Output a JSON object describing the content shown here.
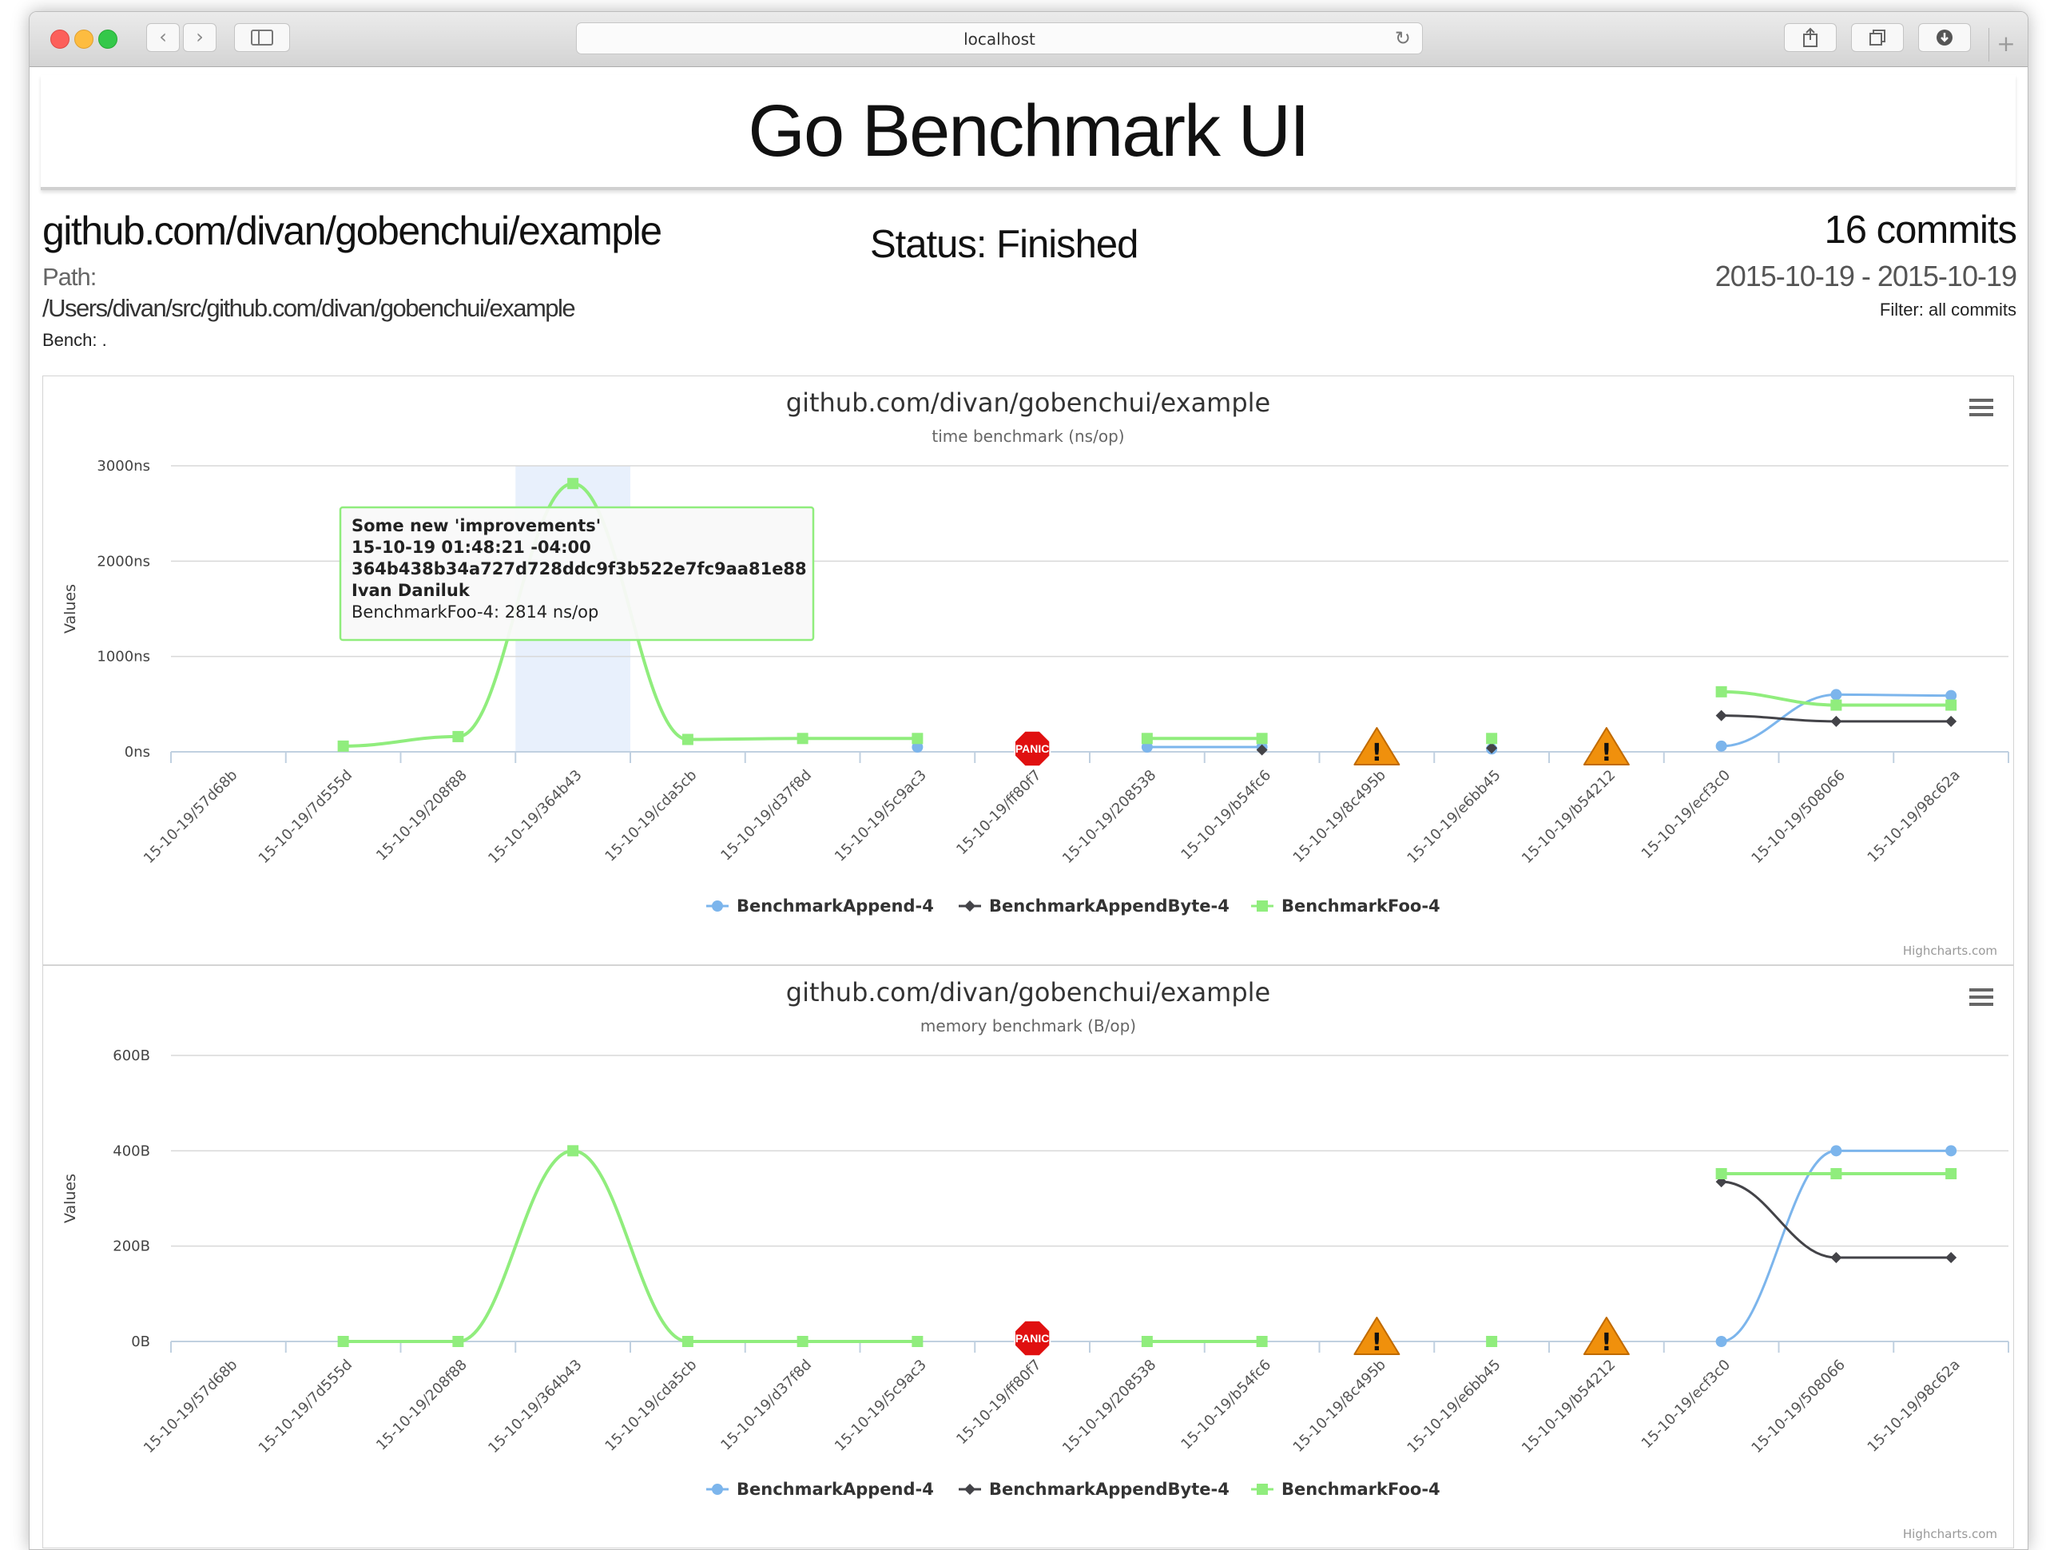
{
  "browser": {
    "url": "localhost",
    "colors": {
      "close": "#fc605b",
      "minimize": "#fdbc40",
      "zoom": "#34c84a"
    }
  },
  "page": {
    "title": "Go Benchmark UI",
    "package": "github.com/divan/gobenchui/example",
    "path_label": "Path:",
    "path": "/Users/divan/src/github.com/divan/gobenchui/example",
    "bench": "Bench: .",
    "status": "Status: Finished",
    "commits": "16 commits",
    "date_range": "2015-10-19 - 2015-10-19",
    "filter": "Filter: all commits"
  },
  "chart_data": [
    {
      "type": "line",
      "title": "github.com/divan/gobenchui/example",
      "subtitle": "time benchmark (ns/op)",
      "ylabel": "Values",
      "ylim": [
        0,
        3000
      ],
      "yticks": [
        "0ns",
        "1000ns",
        "2000ns",
        "3000ns"
      ],
      "ytick_values": [
        0,
        1000,
        2000,
        3000
      ],
      "grid": true,
      "legend": "bottom-center",
      "credits": "Highcharts.com",
      "categories": [
        "15-10-19/57d68b",
        "15-10-19/7d555d",
        "15-10-19/208f88",
        "15-10-19/364b43",
        "15-10-19/cda5cb",
        "15-10-19/d37f8d",
        "15-10-19/5c9ac3",
        "15-10-19/ff80f7",
        "15-10-19/208538",
        "15-10-19/b54fc6",
        "15-10-19/8c495b",
        "15-10-19/e6bb45",
        "15-10-19/b54212",
        "15-10-19/ecf3c0",
        "15-10-19/508066",
        "15-10-19/98c62a"
      ],
      "series": [
        {
          "name": "BenchmarkAppend-4",
          "color": "#7cb5ec",
          "marker": "circle",
          "values": [
            null,
            null,
            null,
            null,
            null,
            null,
            50,
            null,
            50,
            50,
            null,
            30,
            null,
            60,
            600,
            590
          ]
        },
        {
          "name": "BenchmarkAppendByte-4",
          "color": "#434348",
          "marker": "diamond",
          "values": [
            null,
            null,
            null,
            null,
            null,
            null,
            null,
            null,
            null,
            20,
            null,
            40,
            null,
            380,
            320,
            320
          ]
        },
        {
          "name": "BenchmarkFoo-4",
          "color": "#90ed7d",
          "marker": "square",
          "values": [
            null,
            60,
            160,
            2814,
            130,
            140,
            140,
            null,
            140,
            140,
            null,
            140,
            null,
            630,
            490,
            490
          ]
        }
      ],
      "error_markers": [
        {
          "category": "15-10-19/ff80f7",
          "kind": "panic",
          "label": "PANIC"
        },
        {
          "category": "15-10-19/8c495b",
          "kind": "warning",
          "label": "!"
        },
        {
          "category": "15-10-19/b54212",
          "kind": "warning",
          "label": "!"
        }
      ],
      "highlight_category": "15-10-19/364b43",
      "tooltip": {
        "lines": [
          "Some new 'improvements'",
          "15-10-19 01:48:21 -04:00",
          "364b438b34a727d728ddc9f3b522e7fc9aa81e88",
          "Ivan Daniluk",
          "BenchmarkFoo-4: 2814 ns/op"
        ],
        "border_color": "#90ed7d"
      }
    },
    {
      "type": "line",
      "title": "github.com/divan/gobenchui/example",
      "subtitle": "memory benchmark (B/op)",
      "ylabel": "Values",
      "ylim": [
        0,
        600
      ],
      "yticks": [
        "0B",
        "200B",
        "400B",
        "600B"
      ],
      "ytick_values": [
        0,
        200,
        400,
        600
      ],
      "grid": true,
      "legend": "bottom-center",
      "credits": "Highcharts.com",
      "categories": [
        "15-10-19/57d68b",
        "15-10-19/7d555d",
        "15-10-19/208f88",
        "15-10-19/364b43",
        "15-10-19/cda5cb",
        "15-10-19/d37f8d",
        "15-10-19/5c9ac3",
        "15-10-19/ff80f7",
        "15-10-19/208538",
        "15-10-19/b54fc6",
        "15-10-19/8c495b",
        "15-10-19/e6bb45",
        "15-10-19/b54212",
        "15-10-19/ecf3c0",
        "15-10-19/508066",
        "15-10-19/98c62a"
      ],
      "series": [
        {
          "name": "BenchmarkAppend-4",
          "color": "#7cb5ec",
          "marker": "circle",
          "values": [
            null,
            null,
            null,
            null,
            null,
            null,
            null,
            null,
            null,
            null,
            null,
            null,
            null,
            0,
            400,
            400
          ]
        },
        {
          "name": "BenchmarkAppendByte-4",
          "color": "#434348",
          "marker": "diamond",
          "values": [
            null,
            null,
            null,
            null,
            null,
            null,
            null,
            null,
            null,
            null,
            null,
            null,
            null,
            335,
            176,
            176
          ]
        },
        {
          "name": "BenchmarkFoo-4",
          "color": "#90ed7d",
          "marker": "square",
          "values": [
            null,
            0,
            0,
            400,
            0,
            0,
            0,
            null,
            0,
            0,
            null,
            0,
            null,
            352,
            352,
            352
          ]
        }
      ],
      "error_markers": [
        {
          "category": "15-10-19/ff80f7",
          "kind": "panic",
          "label": "PANIC"
        },
        {
          "category": "15-10-19/8c495b",
          "kind": "warning",
          "label": "!"
        },
        {
          "category": "15-10-19/b54212",
          "kind": "warning",
          "label": "!"
        }
      ]
    }
  ]
}
